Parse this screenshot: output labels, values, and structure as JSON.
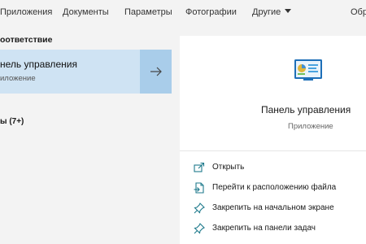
{
  "tabs": [
    {
      "label": "Приложения"
    },
    {
      "label": "Документы"
    },
    {
      "label": "Параметры"
    },
    {
      "label": "Фотографии"
    },
    {
      "label": "Другие"
    },
    {
      "label": "Обр"
    }
  ],
  "left": {
    "best_match_heading": "оответствие",
    "best_result": {
      "title": "нель управления",
      "subtitle": "иложение"
    },
    "more_heading": "ы (7+)"
  },
  "details": {
    "icon": "control-panel-icon",
    "title": "Панель управления",
    "subtitle": "Приложение",
    "actions": [
      {
        "label": "Открыть",
        "icon": "open-icon"
      },
      {
        "label": "Перейти к расположению файла",
        "icon": "file-location-icon"
      },
      {
        "label": "Закрепить на начальном экране",
        "icon": "pin-start-icon"
      },
      {
        "label": "Закрепить на панели задач",
        "icon": "pin-taskbar-icon"
      }
    ]
  },
  "colors": {
    "selected_bg": "#cfe3f3",
    "selected_arrow_bg": "#a9cdea",
    "action_icon": "#1f7a8c"
  }
}
